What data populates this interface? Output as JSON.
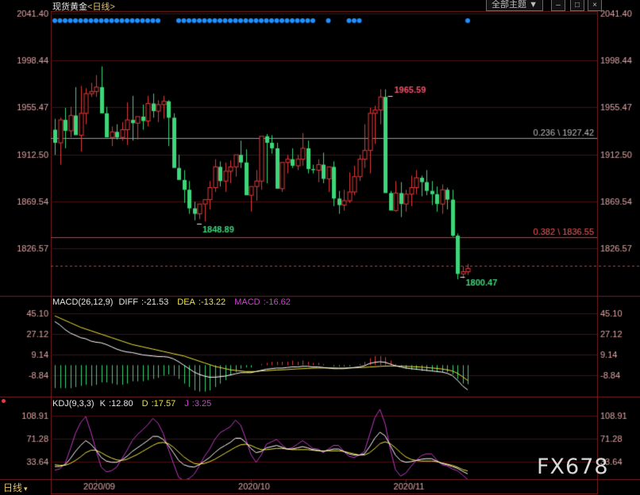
{
  "header": {
    "symbol": "现货黄金",
    "period": "日线",
    "theme_button": "全部主题",
    "theme_caret": "▼",
    "win_min": "–",
    "win_close": "×"
  },
  "bottom": {
    "period_tab": "日线",
    "caret": "▾"
  },
  "watermark": "FX678",
  "colors": {
    "up": "#e23b3b",
    "down": "#3ed67a",
    "grid": "#4a0f0f",
    "axis_text": "#e0a6a6",
    "diff": "#ffffff",
    "dea": "#f0e33a",
    "macd_lbl": "#d041d0",
    "dot": "#1e90ff"
  },
  "chart_data": [
    {
      "type": "candlestick",
      "title": "现货黄金 日线",
      "ylim": [
        1783.6,
        2041.4
      ],
      "yticks": [
        "2041.40",
        "1998.44",
        "1955.47",
        "1912.50",
        "1869.54",
        "1826.57"
      ],
      "xticks": [
        {
          "i": 8,
          "label": "2020/09"
        },
        {
          "i": 38,
          "label": "2020/10"
        },
        {
          "i": 68,
          "label": "2020/11"
        }
      ],
      "candles": [
        [
          1935,
          1945,
          1912,
          1923
        ],
        [
          1923,
          1946,
          1903,
          1944
        ],
        [
          1944,
          1955,
          1918,
          1934
        ],
        [
          1934,
          1956,
          1928,
          1948
        ],
        [
          1948,
          1974,
          1932,
          1930
        ],
        [
          1930,
          1975,
          1915,
          1950
        ],
        [
          1950,
          1973,
          1940,
          1968
        ],
        [
          1968,
          1978,
          1965,
          1970
        ],
        [
          1970,
          1985,
          1965,
          1974
        ],
        [
          1974,
          1993,
          1965,
          1950
        ],
        [
          1950,
          1956,
          1936,
          1928
        ],
        [
          1928,
          1938,
          1920,
          1933
        ],
        [
          1933,
          1940,
          1926,
          1928
        ],
        [
          1928,
          1942,
          1925,
          1935
        ],
        [
          1935,
          1960,
          1921,
          1944
        ],
        [
          1944,
          1966,
          1925,
          1941
        ],
        [
          1941,
          1946,
          1926,
          1947
        ],
        [
          1947,
          1958,
          1935,
          1943
        ],
        [
          1943,
          1966,
          1938,
          1959
        ],
        [
          1959,
          1968,
          1946,
          1952
        ],
        [
          1952,
          1962,
          1942,
          1958
        ],
        [
          1958,
          1966,
          1945,
          1961
        ],
        [
          1961,
          1962,
          1920,
          1946
        ],
        [
          1946,
          1950,
          1908,
          1900
        ],
        [
          1900,
          1912,
          1893,
          1889
        ],
        [
          1889,
          1898,
          1868,
          1880
        ],
        [
          1880,
          1888,
          1858,
          1863
        ],
        [
          1863,
          1869,
          1852,
          1858
        ],
        [
          1858,
          1867,
          1853,
          1867
        ],
        [
          1867,
          1869,
          1851,
          1871
        ],
        [
          1871,
          1888,
          1862,
          1882
        ],
        [
          1882,
          1908,
          1878,
          1901
        ],
        [
          1901,
          1906,
          1883,
          1888
        ],
        [
          1888,
          1905,
          1878,
          1897
        ],
        [
          1897,
          1907,
          1886,
          1901
        ],
        [
          1901,
          1912,
          1892,
          1912
        ],
        [
          1912,
          1925,
          1900,
          1905
        ],
        [
          1905,
          1917,
          1890,
          1875
        ],
        [
          1875,
          1882,
          1860,
          1883
        ],
        [
          1883,
          1898,
          1870,
          1888
        ],
        [
          1888,
          1923,
          1880,
          1929
        ],
        [
          1929,
          1931,
          1886,
          1923
        ],
        [
          1923,
          1930,
          1913,
          1918
        ],
        [
          1918,
          1923,
          1883,
          1881
        ],
        [
          1881,
          1905,
          1878,
          1905
        ],
        [
          1905,
          1912,
          1895,
          1908
        ],
        [
          1908,
          1918,
          1900,
          1902
        ],
        [
          1902,
          1912,
          1898,
          1908
        ],
        [
          1908,
          1932,
          1902,
          1918
        ],
        [
          1918,
          1925,
          1895,
          1899
        ],
        [
          1899,
          1903,
          1895,
          1898
        ],
        [
          1898,
          1908,
          1887,
          1903
        ],
        [
          1903,
          1914,
          1886,
          1890
        ],
        [
          1890,
          1899,
          1878,
          1901
        ],
        [
          1901,
          1906,
          1865,
          1872
        ],
        [
          1872,
          1879,
          1858,
          1866
        ],
        [
          1866,
          1880,
          1861,
          1870
        ],
        [
          1870,
          1896,
          1868,
          1878
        ],
        [
          1878,
          1902,
          1875,
          1892
        ],
        [
          1892,
          1912,
          1888,
          1908
        ],
        [
          1908,
          1940,
          1900,
          1916
        ],
        [
          1916,
          1955,
          1895,
          1950
        ],
        [
          1950,
          1957,
          1922,
          1953
        ],
        [
          1953,
          1972,
          1940,
          1965
        ],
        [
          1965,
          1972,
          1908,
          1877
        ],
        [
          1877,
          1879,
          1866,
          1861
        ],
        [
          1861,
          1888,
          1860,
          1877
        ],
        [
          1877,
          1887,
          1855,
          1867
        ],
        [
          1867,
          1880,
          1860,
          1876
        ],
        [
          1876,
          1893,
          1865,
          1882
        ],
        [
          1882,
          1898,
          1876,
          1891
        ],
        [
          1891,
          1893,
          1874,
          1887
        ],
        [
          1887,
          1898,
          1875,
          1879
        ],
        [
          1879,
          1888,
          1866,
          1876
        ],
        [
          1876,
          1883,
          1860,
          1867
        ],
        [
          1867,
          1885,
          1858,
          1880
        ],
        [
          1880,
          1882,
          1862,
          1871
        ],
        [
          1871,
          1880,
          1837,
          1838
        ],
        [
          1838,
          1840,
          1798,
          1803
        ],
        [
          1803,
          1810,
          1799,
          1805
        ],
        [
          1805,
          1812,
          1802,
          1808
        ]
      ],
      "hlines": [
        {
          "value": 1927.42,
          "label": "0.236 \\ 1927.42"
        },
        {
          "value": 1836.55,
          "label": "0.382 \\ 1836.55"
        },
        {
          "value": 1810.5,
          "label": ""
        }
      ],
      "annotations": [
        {
          "i": 65,
          "value": 1965.59,
          "label": "1965.59",
          "kind": "high"
        },
        {
          "i": 28,
          "value": 1848.89,
          "label": "1848.89",
          "kind": "low"
        },
        {
          "i": 79,
          "value": 1800.47,
          "label": "1800.47",
          "kind": "low"
        }
      ],
      "signal_dots": [
        0,
        1,
        2,
        3,
        4,
        5,
        6,
        7,
        8,
        9,
        10,
        11,
        12,
        13,
        14,
        15,
        16,
        17,
        18,
        19,
        20,
        24,
        25,
        26,
        27,
        28,
        29,
        30,
        31,
        32,
        33,
        34,
        35,
        36,
        37,
        38,
        39,
        40,
        41,
        42,
        43,
        44,
        45,
        46,
        47,
        48,
        49,
        50,
        53,
        57,
        58,
        59,
        80
      ]
    },
    {
      "type": "bar",
      "title": "MACD(26,12,9)",
      "legend": [
        {
          "name": "DIFF",
          "value": "-21.53"
        },
        {
          "name": "DEA",
          "value": "-13.22"
        },
        {
          "name": "MACD",
          "value": "-16.62"
        }
      ],
      "yticks": [
        "45.10",
        "27.12",
        "9.14",
        "-8.84"
      ],
      "ylim": [
        -26.0,
        50.0
      ],
      "diff": [
        38.0,
        35.0,
        31.0,
        28.0,
        26.0,
        24.0,
        23.0,
        21.0,
        20.0,
        19.5,
        18.0,
        16.0,
        14.0,
        12.5,
        11.5,
        11.0,
        10.0,
        9.0,
        8.5,
        8.0,
        7.5,
        7.5,
        7.0,
        5.5,
        3.0,
        0.0,
        -3.0,
        -6.0,
        -8.0,
        -9.5,
        -10.5,
        -10.5,
        -10.0,
        -9.5,
        -8.5,
        -7.5,
        -6.5,
        -6.5,
        -6.5,
        -5.5,
        -4.5,
        -3.5,
        -3.0,
        -2.5,
        -2.5,
        -2.0,
        -1.5,
        -1.5,
        -1.0,
        -1.0,
        -1.5,
        -1.5,
        -2.0,
        -2.5,
        -3.0,
        -3.0,
        -3.0,
        -2.5,
        -2.0,
        -1.5,
        -0.5,
        1.5,
        2.5,
        3.0,
        2.5,
        1.0,
        -0.5,
        -1.5,
        -2.5,
        -3.0,
        -3.5,
        -4.0,
        -4.5,
        -5.0,
        -5.5,
        -6.0,
        -7.0,
        -9.0,
        -13.0,
        -18.0,
        -21.53
      ],
      "dea": [
        43.0,
        41.0,
        39.0,
        37.0,
        35.0,
        33.0,
        31.5,
        30.0,
        28.5,
        27.0,
        25.5,
        24.0,
        22.5,
        21.0,
        19.5,
        18.0,
        17.0,
        16.0,
        15.0,
        14.0,
        13.0,
        12.0,
        11.0,
        10.0,
        9.0,
        8.0,
        6.5,
        5.0,
        3.5,
        2.0,
        0.5,
        -1.0,
        -2.0,
        -3.0,
        -4.0,
        -4.5,
        -5.0,
        -5.5,
        -5.5,
        -5.5,
        -5.0,
        -4.8,
        -4.5,
        -4.2,
        -4.0,
        -3.8,
        -3.5,
        -3.2,
        -3.0,
        -2.8,
        -2.6,
        -2.5,
        -2.4,
        -2.4,
        -2.4,
        -2.5,
        -2.5,
        -2.4,
        -2.3,
        -2.1,
        -1.9,
        -1.6,
        -1.3,
        -1.0,
        -0.8,
        -0.7,
        -0.7,
        -0.8,
        -1.0,
        -1.2,
        -1.4,
        -1.7,
        -2.0,
        -2.4,
        -2.8,
        -3.3,
        -4.0,
        -5.0,
        -7.0,
        -10.0,
        -13.22
      ],
      "macd": [
        -20,
        -20,
        -20,
        -20,
        -19,
        -18,
        -17,
        -18,
        -17,
        -15,
        -15,
        -16,
        -17,
        -17,
        -16,
        -14,
        -14,
        -14,
        -13,
        -12,
        -11,
        -9,
        -8,
        -9,
        -12,
        -16,
        -19,
        -22,
        -23,
        -23,
        -22,
        -19,
        -16,
        -13,
        -9,
        -6,
        -3,
        -2,
        -2,
        0,
        1,
        2,
        3,
        3,
        3,
        3,
        4,
        3,
        4,
        3,
        2,
        2,
        1,
        0,
        -1,
        -1,
        -1,
        -1,
        0,
        1,
        3,
        6,
        8,
        8,
        7,
        4,
        1,
        -1,
        -3,
        -4,
        -4,
        -5,
        -5,
        -5,
        -6,
        -6,
        -6,
        -8,
        -12,
        -16,
        -16.62
      ]
    },
    {
      "type": "line",
      "title": "KDJ(9,3,3)",
      "legend": [
        {
          "name": "K",
          "value": "12.80"
        },
        {
          "name": "D",
          "value": "17.57"
        },
        {
          "name": "J",
          "value": "3.25"
        }
      ],
      "yticks": [
        "108.91",
        "71.28",
        "33.64"
      ],
      "ylim": [
        4.0,
        120.0
      ],
      "k": [
        25,
        25,
        28,
        38,
        50,
        60,
        68,
        62,
        52,
        40,
        34,
        32,
        32,
        36,
        42,
        50,
        56,
        62,
        68,
        75,
        75,
        70,
        60,
        48,
        35,
        28,
        25,
        24,
        28,
        34,
        40,
        48,
        55,
        60,
        65,
        72,
        72,
        65,
        55,
        48,
        50,
        56,
        58,
        60,
        57,
        54,
        54,
        56,
        58,
        56,
        53,
        52,
        50,
        52,
        54,
        54,
        50,
        46,
        44,
        44,
        46,
        58,
        72,
        82,
        76,
        60,
        44,
        35,
        32,
        33,
        35,
        37,
        38,
        38,
        34,
        30,
        28,
        25,
        22,
        17,
        12.8
      ],
      "d": [
        28,
        27,
        27,
        30,
        35,
        41,
        48,
        52,
        52,
        48,
        43,
        39,
        36,
        35,
        37,
        41,
        45,
        50,
        55,
        60,
        64,
        65,
        63,
        57,
        49,
        41,
        35,
        30,
        29,
        30,
        33,
        37,
        42,
        47,
        52,
        57,
        61,
        62,
        60,
        56,
        53,
        53,
        54,
        55,
        55,
        54,
        53,
        53,
        53,
        53,
        52,
        51,
        51,
        51,
        51,
        51,
        50,
        48,
        46,
        44,
        44,
        48,
        55,
        63,
        66,
        63,
        56,
        48,
        41,
        37,
        35,
        34,
        34,
        34,
        33,
        31,
        29,
        27,
        24,
        20,
        17.57
      ],
      "j": [
        19,
        21,
        30,
        54,
        80,
        98,
        108,
        82,
        52,
        24,
        16,
        18,
        24,
        38,
        52,
        68,
        78,
        86,
        94,
        105,
        97,
        80,
        54,
        30,
        7,
        2,
        5,
        12,
        26,
        42,
        54,
        70,
        81,
        86,
        91,
        102,
        94,
        71,
        45,
        32,
        44,
        62,
        66,
        70,
        61,
        54,
        56,
        62,
        68,
        62,
        55,
        54,
        48,
        54,
        60,
        60,
        50,
        42,
        40,
        44,
        50,
        78,
        106,
        120,
        96,
        54,
        20,
        9,
        14,
        25,
        35,
        43,
        46,
        46,
        36,
        28,
        26,
        21,
        18,
        11,
        3.25
      ]
    }
  ]
}
